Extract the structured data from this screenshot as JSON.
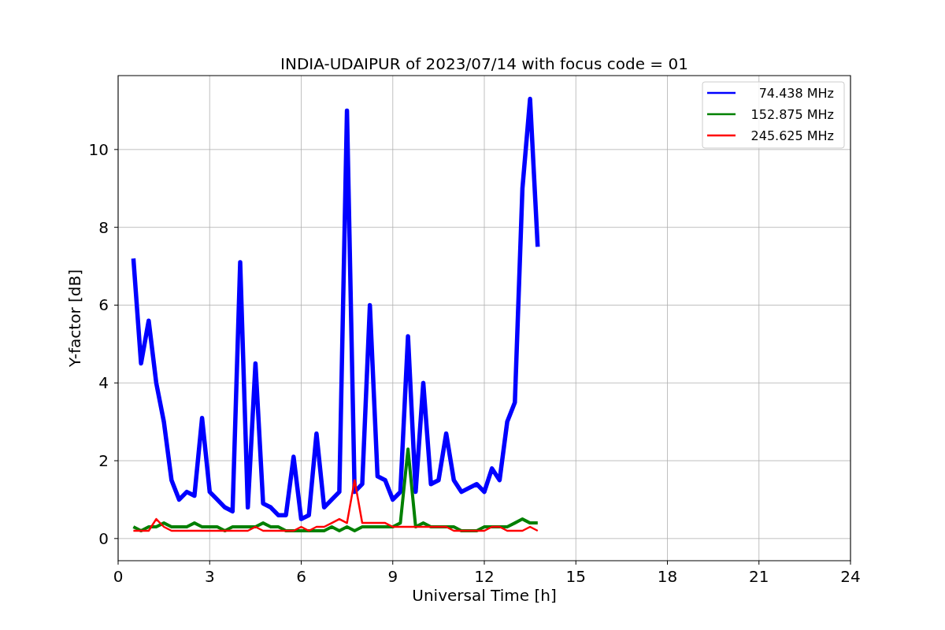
{
  "chart_data": {
    "type": "line",
    "title": "INDIA-UDAIPUR of 2023/07/14 with focus code = 01",
    "xlabel": "Universal Time [h]",
    "ylabel": "Y-factor [dB]",
    "x": [
      0.5,
      0.75,
      1.0,
      1.25,
      1.5,
      1.75,
      2.0,
      2.25,
      2.5,
      2.75,
      3.0,
      3.25,
      3.5,
      3.75,
      4.0,
      4.25,
      4.5,
      4.75,
      5.0,
      5.25,
      5.5,
      5.75,
      6.0,
      6.25,
      6.5,
      6.75,
      7.0,
      7.25,
      7.5,
      7.75,
      8.0,
      8.25,
      8.5,
      8.75,
      9.0,
      9.25,
      9.5,
      9.75,
      10.0,
      10.25,
      10.5,
      10.75,
      11.0,
      11.25,
      11.5,
      11.75,
      12.0,
      12.25,
      12.5,
      12.75,
      13.0,
      13.25,
      13.5,
      13.75
    ],
    "series": [
      {
        "name": "74.438 MHz",
        "color": "#0000ff",
        "values": [
          7.2,
          4.5,
          5.6,
          4.0,
          3.0,
          1.5,
          1.0,
          1.2,
          1.1,
          3.1,
          1.2,
          1.0,
          0.8,
          0.7,
          7.1,
          0.8,
          4.5,
          0.9,
          0.8,
          0.6,
          0.6,
          2.1,
          0.5,
          0.6,
          2.7,
          0.8,
          1.0,
          1.2,
          11.0,
          1.2,
          1.4,
          6.0,
          1.6,
          1.5,
          1.0,
          1.2,
          5.2,
          1.2,
          4.0,
          1.4,
          1.5,
          2.7,
          1.5,
          1.2,
          1.3,
          1.4,
          1.2,
          1.8,
          1.5,
          3.0,
          3.5,
          9.0,
          11.3,
          7.5
        ]
      },
      {
        "name": "152.875 MHz",
        "color": "#008000",
        "values": [
          0.3,
          0.2,
          0.3,
          0.3,
          0.4,
          0.3,
          0.3,
          0.3,
          0.4,
          0.3,
          0.3,
          0.3,
          0.2,
          0.3,
          0.3,
          0.3,
          0.3,
          0.4,
          0.3,
          0.3,
          0.2,
          0.2,
          0.2,
          0.2,
          0.2,
          0.2,
          0.3,
          0.2,
          0.3,
          0.2,
          0.3,
          0.3,
          0.3,
          0.3,
          0.3,
          0.4,
          2.3,
          0.3,
          0.4,
          0.3,
          0.3,
          0.3,
          0.3,
          0.2,
          0.2,
          0.2,
          0.3,
          0.3,
          0.3,
          0.3,
          0.4,
          0.5,
          0.4,
          0.4
        ]
      },
      {
        "name": "245.625 MHz",
        "color": "#ff0000",
        "values": [
          0.2,
          0.2,
          0.2,
          0.5,
          0.3,
          0.2,
          0.2,
          0.2,
          0.2,
          0.2,
          0.2,
          0.2,
          0.2,
          0.2,
          0.2,
          0.2,
          0.3,
          0.2,
          0.2,
          0.2,
          0.2,
          0.2,
          0.3,
          0.2,
          0.3,
          0.3,
          0.4,
          0.5,
          0.4,
          1.5,
          0.4,
          0.4,
          0.4,
          0.4,
          0.3,
          0.3,
          0.3,
          0.3,
          0.3,
          0.3,
          0.3,
          0.3,
          0.2,
          0.2,
          0.2,
          0.2,
          0.2,
          0.3,
          0.3,
          0.2,
          0.2,
          0.2,
          0.3,
          0.2
        ]
      }
    ],
    "xlim": [
      0,
      24
    ],
    "ylim": [
      -0.57,
      11.9
    ],
    "xticks": [
      0,
      3,
      6,
      9,
      12,
      15,
      18,
      21,
      24
    ],
    "yticks": [
      0,
      2,
      4,
      6,
      8,
      10
    ],
    "grid": true,
    "legend": true
  }
}
